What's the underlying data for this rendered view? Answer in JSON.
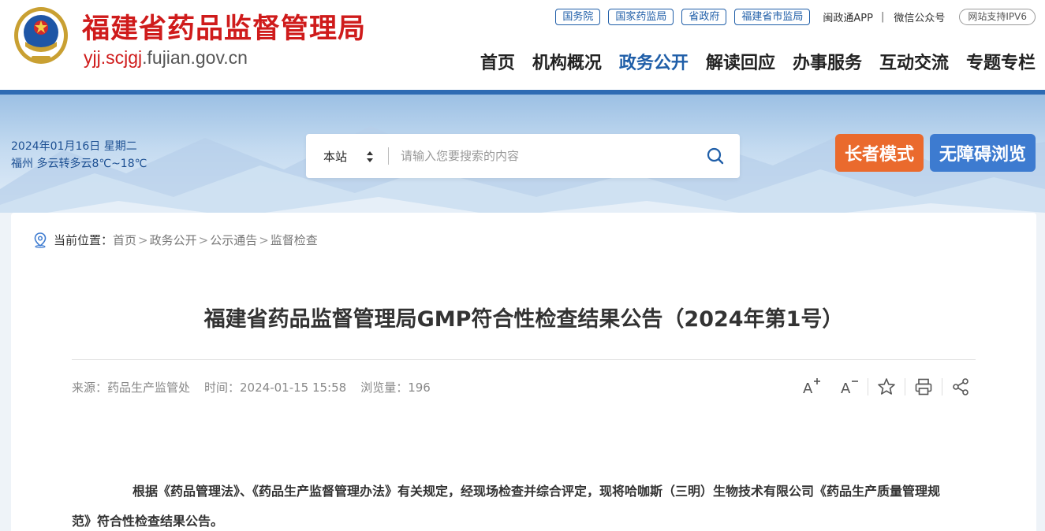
{
  "header": {
    "site_title": "福建省药品监督管理局",
    "domain_highlight": "yjj.scjgj",
    "domain_rest": ".fujian.gov.cn",
    "gov_links": [
      "国务院",
      "国家药监局",
      "省政府",
      "福建省市监局"
    ],
    "app_link": "闽政通APP",
    "wechat_link": "微信公众号",
    "ipv6_badge": "网站支持IPV6",
    "nav": [
      {
        "label": "首页",
        "active": false
      },
      {
        "label": "机构概况",
        "active": false
      },
      {
        "label": "政务公开",
        "active": true
      },
      {
        "label": "解读回应",
        "active": false
      },
      {
        "label": "办事服务",
        "active": false
      },
      {
        "label": "互动交流",
        "active": false
      },
      {
        "label": "专题专栏",
        "active": false
      }
    ]
  },
  "banner": {
    "date": "2024年01月16日 星期二",
    "weather": "福州 多云转多云8℃~18℃",
    "search": {
      "scope": "本站",
      "placeholder": "请输入您要搜索的内容"
    },
    "elder_mode": "长者模式",
    "accessible": "无障碍浏览"
  },
  "breadcrumb": {
    "label": "当前位置：",
    "items": [
      "首页",
      "政务公开",
      "公示通告",
      "监督检查"
    ],
    "separator": ">"
  },
  "article": {
    "title": "福建省药品监督管理局GMP符合性检查结果公告（2024年第1号）",
    "source": "来源：药品生产监管处",
    "time": "时间：2024-01-15 15:58",
    "views": "浏览量：196",
    "body": "根据《药品管理法》、《药品生产监督管理办法》有关规定，经现场检查并综合评定，现将哈咖斯（三明）生物技术有限公司《药品生产质量管理规范》符合性检查结果公告。"
  },
  "tools": [
    {
      "name": "font-increase-icon"
    },
    {
      "name": "font-decrease-icon"
    },
    {
      "name": "star-icon"
    },
    {
      "name": "print-icon"
    },
    {
      "name": "share-icon"
    }
  ],
  "colors": {
    "brand_red": "#cf1b1b",
    "brand_blue": "#1f5ea8",
    "elder_orange": "#ea6a2d",
    "access_blue": "#3d7bd0"
  }
}
